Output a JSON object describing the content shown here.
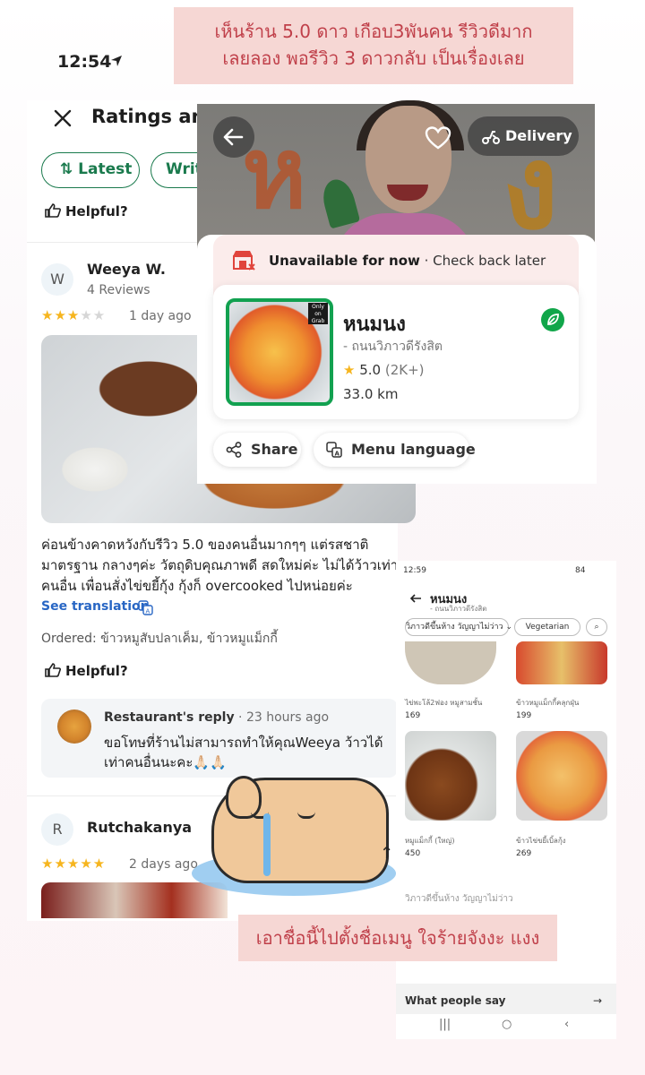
{
  "captions": {
    "top_line1": "เห็นร้าน 5.0 ดาว เกือบ3พันคน รีวิวดีมาก",
    "top_line2": "เลยลอง พอรีวิว 3 ดาวกลับ เป็นเรื่องเลย",
    "bottom": "เอาชื่อนี้ไปตั้งชื่อเมนู ใจร้ายจังงะ แงง"
  },
  "status_bar": {
    "time": "12:54"
  },
  "ratings": {
    "title": "Ratings and",
    "filters": [
      "Latest",
      "Writ"
    ],
    "helpful_label": "Helpful?",
    "reviews": [
      {
        "avatar_letter": "W",
        "name": "Weeya W.",
        "reviews_count": "4 Reviews",
        "stars": 3,
        "time": "1 day ago",
        "text": "ค่อนข้างคาดหวังกับรีวิว 5.0 ของคนอื่นมากๆๆ แต่รสชาติมาตรฐาน กลางๆค่ะ วัตถุดิบคุณภาพดี สดใหม่ค่ะ ไม่ได้ว้าวเท่าคนอื่น เพื่อนสั่งไข่ขยี้กุ้ง กุ้งก็ overcooked ไปหน่อยค่ะ",
        "see_translation": "See translation",
        "ordered": "Ordered: ข้าวหมูสับปลาเค็ม, ข้าวหมูแม็กกี้",
        "reply": {
          "label": "Restaurant's reply",
          "time": "23 hours ago",
          "text": "ขอโทษที่ร้านไม่สามารถทำให้คุณWeeya ว้าวได้เท่าคนอื่นนะคะ🙏🏻🙏🏻"
        }
      },
      {
        "avatar_letter": "R",
        "name": "Rutchakanya",
        "stars": 5,
        "time": "2 days ago"
      }
    ]
  },
  "restaurant": {
    "delivery_label": "Delivery",
    "unavailable_bold": "Unavailable for now",
    "unavailable_rest": " · Check back later",
    "name": "หนมนง",
    "branch": "- ถนนวิภาวดีรังสิต",
    "rating": "5.0",
    "rating_count": "(2K+)",
    "distance": "33.0 km",
    "share_label": "Share",
    "menu_language_label": "Menu language",
    "grab_tag": "Only on Grab"
  },
  "menu_screen": {
    "time": "12:59",
    "battery": "84",
    "title": "หนมนง",
    "subtitle": "- ถนนวิภาวดีรังสิต",
    "chips": [
      "วิภาวดีขึ้นห้าง วัญญาไม่ว่าว",
      "Vegetarian"
    ],
    "items": [
      {
        "name": "ไข่พะโล้2ฟอง หมูสามชั้น",
        "price": "169"
      },
      {
        "name": "ข้าวหมูแม็กกี้คลุกฝุ่น",
        "price": "199"
      },
      {
        "name": "หมูแม็กกี้ (ใหญ่)",
        "price": "450"
      },
      {
        "name": "ข้าวไข่ขยี้เบิ้ลกุ้ง",
        "price": "269"
      }
    ],
    "section_title": "วิภาวดีขึ้นห้าง วัญญาไม่ว่าว",
    "people_say": "What people say"
  },
  "colors": {
    "caption_bg": "#f6d7d4",
    "caption_text": "#c0404a",
    "grab_green": "#1a7a4d",
    "star": "#f6b51e",
    "link_blue": "#2866c4"
  }
}
